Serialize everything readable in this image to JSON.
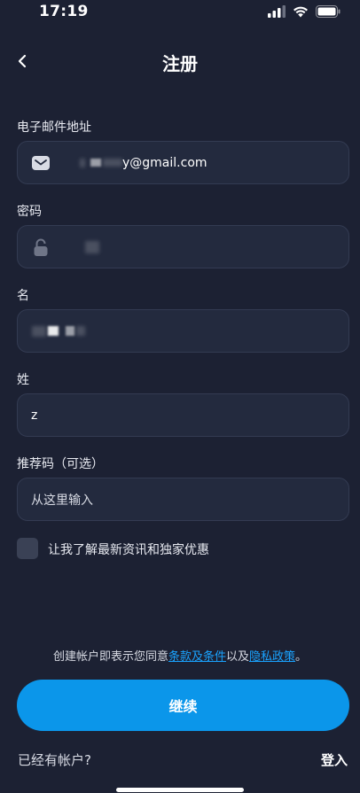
{
  "status_bar": {
    "time": "17:19"
  },
  "header": {
    "title": "注册"
  },
  "form": {
    "email": {
      "label": "电子邮件地址",
      "value_visible": "y@gmail.com"
    },
    "password": {
      "label": "密码"
    },
    "first_name": {
      "label": "名"
    },
    "last_name": {
      "label": "姓",
      "value": "z"
    },
    "referral": {
      "label": "推荐码（可选）",
      "placeholder": "从这里输入"
    },
    "newsletter": {
      "label": "让我了解最新资讯和独家优惠",
      "checked": false
    }
  },
  "terms": {
    "prefix": "创建帐户即表示您同意",
    "terms_link": "条款及条件",
    "middle": "以及",
    "privacy_link": "隐私政策",
    "suffix": "。"
  },
  "actions": {
    "continue_label": "继续",
    "have_account": "已经有帐户?",
    "login_label": "登入"
  },
  "colors": {
    "background": "#1c2133",
    "field_bg": "#232a3e",
    "accent": "#0b96ea",
    "link": "#1aa3ff"
  }
}
